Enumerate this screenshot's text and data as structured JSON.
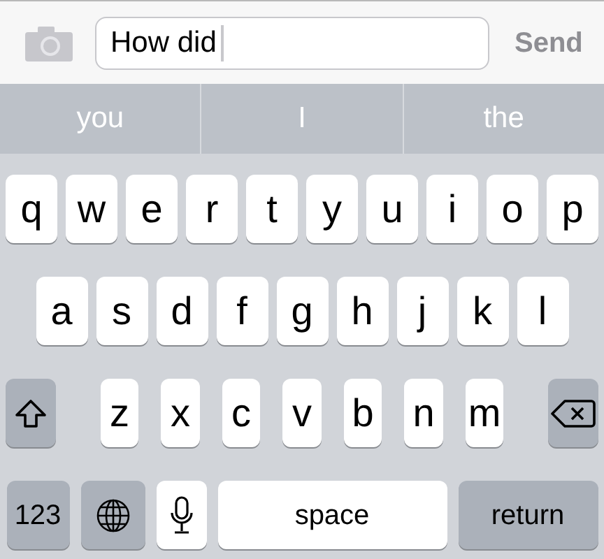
{
  "compose_bar": {
    "message": "How did",
    "send": {
      "label": "Send",
      "disabled": true
    }
  },
  "suggestions": [
    {
      "text": "you"
    },
    {
      "text": "I"
    },
    {
      "text": "the"
    }
  ],
  "keyboard": {
    "rows": [
      {
        "keys": [
          {
            "kind": "letter",
            "label": "q"
          },
          {
            "kind": "letter",
            "label": "w"
          },
          {
            "kind": "letter",
            "label": "e"
          },
          {
            "kind": "letter",
            "label": "r"
          },
          {
            "kind": "letter",
            "label": "t"
          },
          {
            "kind": "letter",
            "label": "y"
          },
          {
            "kind": "letter",
            "label": "u"
          },
          {
            "kind": "letter",
            "label": "i"
          },
          {
            "kind": "letter",
            "label": "o"
          },
          {
            "kind": "letter",
            "label": "p"
          }
        ]
      },
      {
        "keys": [
          {
            "kind": "letter",
            "label": "a"
          },
          {
            "kind": "letter",
            "label": "s"
          },
          {
            "kind": "letter",
            "label": "d"
          },
          {
            "kind": "letter",
            "label": "f"
          },
          {
            "kind": "letter",
            "label": "g"
          },
          {
            "kind": "letter",
            "label": "h"
          },
          {
            "kind": "letter",
            "label": "j"
          },
          {
            "kind": "letter",
            "label": "k"
          },
          {
            "kind": "letter",
            "label": "l"
          }
        ]
      },
      {
        "keys": [
          {
            "kind": "shift"
          },
          {
            "kind": "letter",
            "label": "z"
          },
          {
            "kind": "letter",
            "label": "x"
          },
          {
            "kind": "letter",
            "label": "c"
          },
          {
            "kind": "letter",
            "label": "v"
          },
          {
            "kind": "letter",
            "label": "b"
          },
          {
            "kind": "letter",
            "label": "n"
          },
          {
            "kind": "letter",
            "label": "m"
          },
          {
            "kind": "delete"
          }
        ]
      },
      {
        "keys": [
          {
            "kind": "numbers",
            "label": "123"
          },
          {
            "kind": "globe"
          },
          {
            "kind": "mic"
          },
          {
            "kind": "space",
            "label": "space"
          },
          {
            "kind": "return",
            "label": "return"
          }
        ]
      }
    ]
  }
}
